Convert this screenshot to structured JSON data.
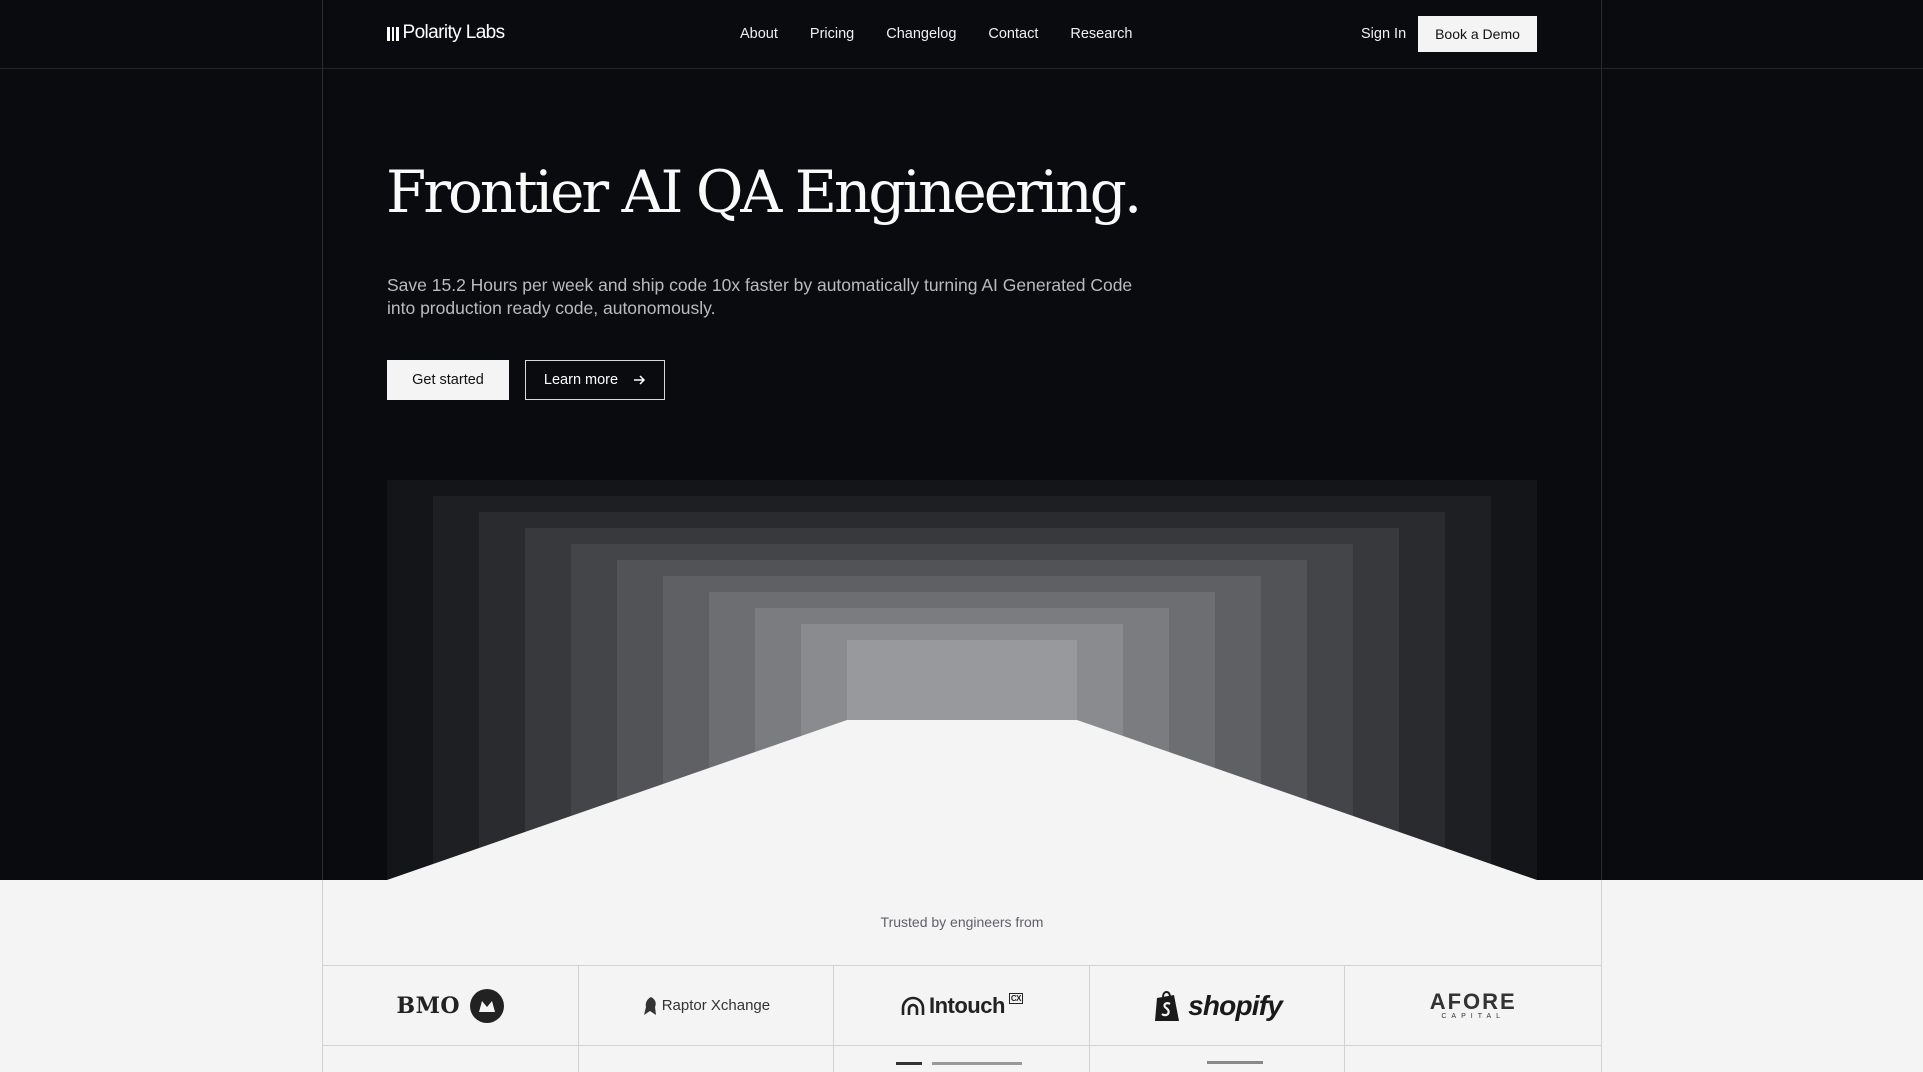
{
  "nav": {
    "brand": "Polarity Labs",
    "links": [
      "About",
      "Pricing",
      "Changelog",
      "Contact",
      "Research"
    ],
    "sign_in": "Sign In",
    "book_demo": "Book a Demo"
  },
  "hero": {
    "title": "Frontier AI QA Engineering.",
    "subtitle": "Save 15.2 Hours per week and ship code 10x faster by automatically turning AI Generated Code into production ready code, autonomously.",
    "primary_cta": "Get started",
    "secondary_cta": "Learn more"
  },
  "trusted": {
    "label": "Trusted by engineers from",
    "logos": {
      "bmo": "BMO",
      "raptor": "Raptor Xchange",
      "intouch": "Intouch",
      "intouch_badge": "CX",
      "shopify": "shopify",
      "afore_main": "AFORE",
      "afore_sub": "CAPITAL"
    }
  },
  "icons": {
    "arrow": "arrow-right-icon",
    "brand_mark": "bars-logo-icon"
  }
}
